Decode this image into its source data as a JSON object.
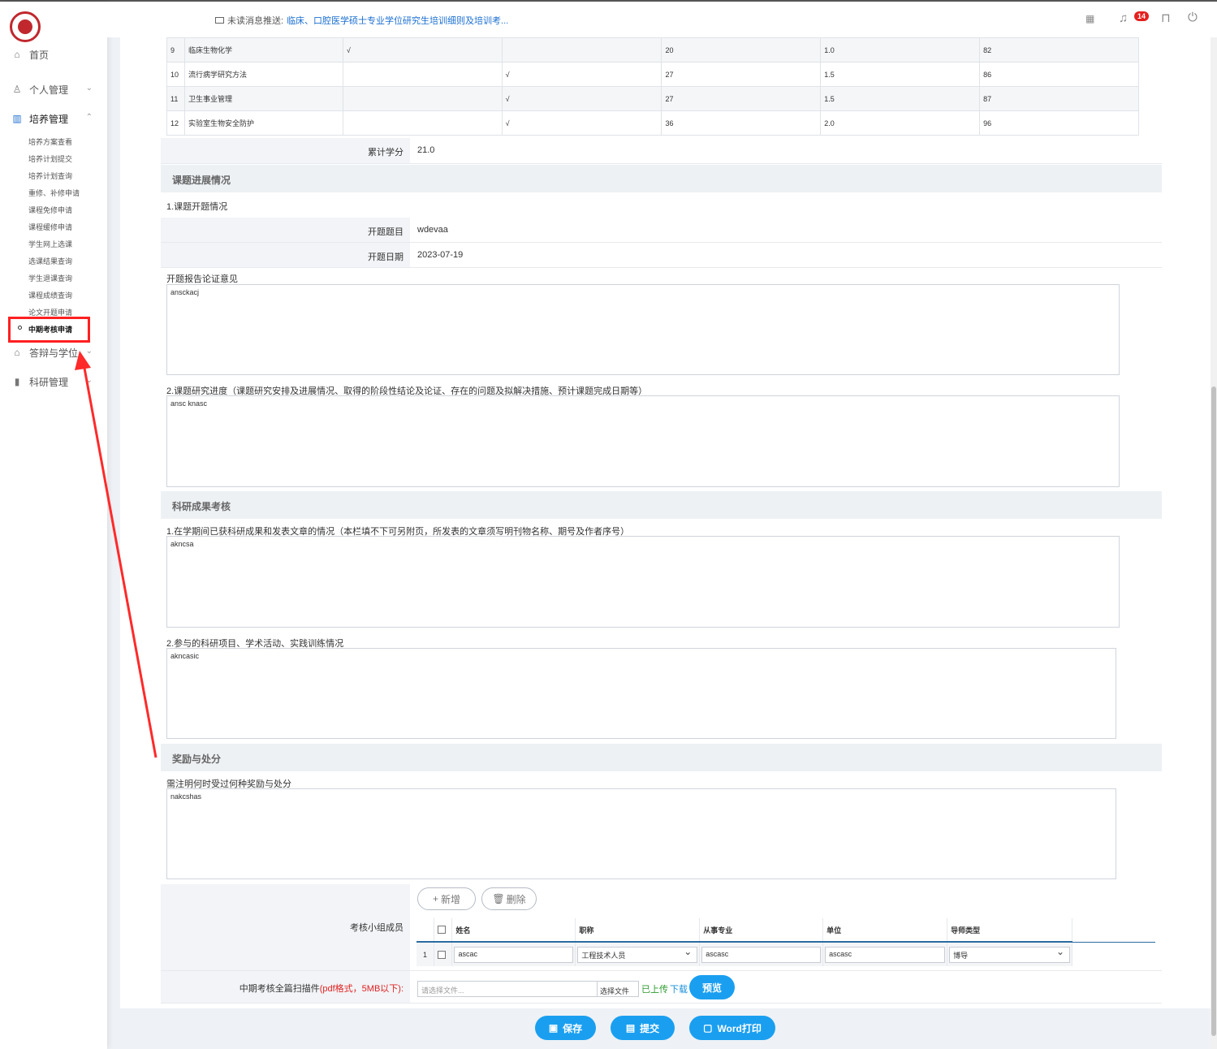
{
  "header": {
    "notice_prefix": "未读消息推送:",
    "notice_link": "临床、口腔医学硕士专业学位研究生培训细则及培训考...",
    "notification_count": "14"
  },
  "sidebar": {
    "home": "首页",
    "personal": "个人管理",
    "training": "培养管理",
    "sub_items": [
      "培养方案查看",
      "培养计划提交",
      "培养计划查询",
      "重修、补修申请",
      "课程免修申请",
      "课程缓修申请",
      "学生网上选课",
      "选课结果查询",
      "学生退课查询",
      "课程成绩查询",
      "论文开题申请",
      "中期考核申请"
    ],
    "defense": "答辩与学位",
    "research": "科研管理"
  },
  "courses": [
    {
      "no": "9",
      "name": "临床生物化学",
      "c1": "√",
      "c2": "",
      "hours": "20",
      "credit": "1.0",
      "score": "82"
    },
    {
      "no": "10",
      "name": "流行病学研究方法",
      "c1": "",
      "c2": "√",
      "hours": "27",
      "credit": "1.5",
      "score": "86"
    },
    {
      "no": "11",
      "name": "卫生事业管理",
      "c1": "",
      "c2": "√",
      "hours": "27",
      "credit": "1.5",
      "score": "87"
    },
    {
      "no": "12",
      "name": "实验室生物安全防护",
      "c1": "",
      "c2": "√",
      "hours": "36",
      "credit": "2.0",
      "score": "96"
    }
  ],
  "form": {
    "total_credit_label": "累计学分",
    "total_credit": "21.0",
    "section_progress": "课题进展情况",
    "opening_heading": "1.课题开题情况",
    "topic_label": "开题题目",
    "topic_value": "wdevaa",
    "date_label": "开题日期",
    "date_value": "2023-07-19",
    "opinion_label": "开题报告论证意见",
    "opinion_value": "ansckacj",
    "progress_label": "2.课题研究进度（课题研究安排及进展情况、取得的阶段性结论及论证、存在的问题及拟解决措施、预计课题完成日期等）",
    "progress_value": "ansc knasc",
    "section_research": "科研成果考核",
    "achievements_label": "1.在学期间已获科研成果和发表文章的情况（本栏填不下可另附页，所发表的文章须写明刊物名称、期号及作者序号）",
    "achievements_value": "akncsa",
    "projects_label": "2.参与的科研项目、学术活动、实践训练情况",
    "projects_value": "akncasic",
    "section_awards": "奖励与处分",
    "awards_label": "需注明何时受过何种奖励与处分",
    "awards_value": "nakcshas",
    "members_label": "考核小组成员",
    "add_label": "新增",
    "delete_label": "删除",
    "member_headers": [
      "姓名",
      "职称",
      "从事专业",
      "单位",
      "导师类型"
    ],
    "member_row": {
      "no": "1",
      "name": "ascac",
      "title": "工程技术人员",
      "major": "ascasc",
      "unit": "ascasc",
      "tutor_type": "博导"
    },
    "attachment_label": "中期考核全篇扫描件",
    "attachment_note": "(pdf格式，5MB以下):",
    "file_placeholder": "请选择文件...",
    "choose_file": "选择文件",
    "uploaded": "已上传",
    "download": "下载",
    "preview": "预览"
  },
  "actions": {
    "save": "保存",
    "submit": "提交",
    "word_print": "Word打印"
  },
  "colors": {
    "accent": "#1a9ff0",
    "annotation": "#ff2020"
  }
}
